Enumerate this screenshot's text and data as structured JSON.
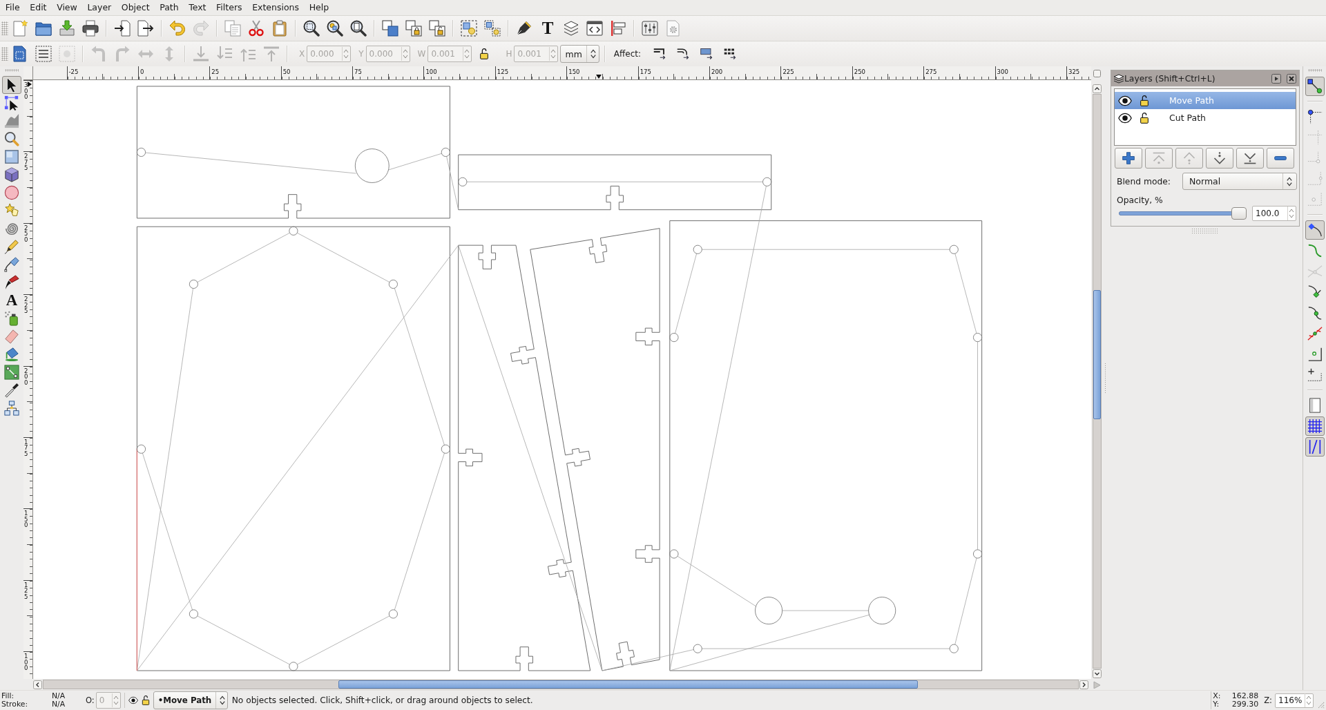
{
  "menu": [
    "File",
    "Edit",
    "View",
    "Layer",
    "Object",
    "Path",
    "Text",
    "Filters",
    "Extensions",
    "Help"
  ],
  "command_bar": [
    [
      {
        "kind": "new",
        "disabled": false
      },
      {
        "kind": "open",
        "disabled": false
      },
      {
        "kind": "save",
        "disabled": false
      },
      {
        "kind": "print",
        "disabled": false
      }
    ],
    [
      {
        "kind": "import",
        "disabled": false
      },
      {
        "kind": "export",
        "disabled": false
      }
    ],
    [
      {
        "kind": "undo",
        "disabled": false
      },
      {
        "kind": "redo",
        "disabled": true
      }
    ],
    [
      {
        "kind": "copy",
        "disabled": false
      },
      {
        "kind": "cut",
        "disabled": false
      },
      {
        "kind": "paste",
        "disabled": false
      }
    ],
    [
      {
        "kind": "zoom_selection",
        "disabled": false
      },
      {
        "kind": "zoom_drawing",
        "disabled": false
      },
      {
        "kind": "zoom_page",
        "disabled": false
      }
    ],
    [
      {
        "kind": "duplicate",
        "disabled": false
      },
      {
        "kind": "clone",
        "disabled": false
      },
      {
        "kind": "unlink_clone",
        "disabled": false
      }
    ],
    [
      {
        "kind": "group",
        "disabled": false
      },
      {
        "kind": "ungroup",
        "disabled": false
      }
    ],
    [
      {
        "kind": "fill_stroke",
        "disabled": false
      },
      {
        "kind": "text",
        "glyph": "T",
        "disabled": false
      },
      {
        "kind": "layers",
        "disabled": false
      },
      {
        "kind": "xml",
        "disabled": false
      },
      {
        "kind": "align",
        "disabled": false
      }
    ],
    [
      {
        "kind": "document_properties",
        "disabled": false
      },
      {
        "kind": "preferences",
        "disabled": false
      }
    ]
  ],
  "tool_controls": {
    "button_groups": [
      [
        {
          "kind": "select_all",
          "disabled": false
        },
        {
          "kind": "select_all_layers",
          "disabled": false
        },
        {
          "kind": "deselect",
          "disabled": true
        }
      ],
      [
        {
          "kind": "rotate_ccw",
          "disabled": true
        },
        {
          "kind": "rotate_cw",
          "disabled": true
        },
        {
          "kind": "flip_h",
          "disabled": true
        },
        {
          "kind": "flip_v",
          "disabled": true
        }
      ],
      [
        {
          "kind": "lower_bottom",
          "disabled": true
        },
        {
          "kind": "lower",
          "disabled": true
        },
        {
          "kind": "raise",
          "disabled": true
        },
        {
          "kind": "raise_top",
          "disabled": true
        }
      ]
    ],
    "fields": [
      {
        "label": "X",
        "value": "0.000",
        "disabled": true
      },
      {
        "label": "Y",
        "value": "0.000",
        "disabled": true
      },
      {
        "label": "W",
        "value": "0.001",
        "disabled": true
      },
      {
        "label": "H",
        "value": "0.001",
        "disabled": true
      }
    ],
    "unit": "mm",
    "affect_label": "Affect:"
  },
  "tools": [
    {
      "kind": "selector",
      "selected": true
    },
    {
      "kind": "node",
      "selected": false
    },
    {
      "kind": "tweak",
      "selected": false
    },
    {
      "kind": "zoom",
      "selected": false
    },
    {
      "kind": "rect",
      "selected": false
    },
    {
      "kind": "box3d",
      "selected": false
    },
    {
      "kind": "ellipse",
      "selected": false
    },
    {
      "kind": "star",
      "selected": false
    },
    {
      "kind": "spiral",
      "selected": false
    },
    {
      "kind": "pencil",
      "selected": false
    },
    {
      "kind": "pen",
      "selected": false
    },
    {
      "kind": "calligraphy",
      "selected": false
    },
    {
      "kind": "text",
      "glyph": "A",
      "selected": false
    },
    {
      "kind": "spray",
      "selected": false
    },
    {
      "kind": "eraser",
      "selected": false
    },
    {
      "kind": "bucket",
      "selected": false
    },
    {
      "kind": "gradient",
      "selected": false
    },
    {
      "kind": "dropper",
      "selected": false
    },
    {
      "kind": "connector",
      "selected": false
    }
  ],
  "rulers": {
    "horizontal": [
      "-25",
      "0",
      "25",
      "50",
      "75",
      "100",
      "125",
      "150",
      "175",
      "200",
      "225",
      "250",
      "275",
      "300",
      "325"
    ],
    "vertical": [
      "300",
      "275",
      "250",
      "225",
      "200",
      "175",
      "150",
      "125",
      "100"
    ]
  },
  "layers_panel": {
    "title": "Layers (Shift+Ctrl+L)",
    "layers": [
      {
        "name": "Move Path",
        "selected": true,
        "visible": true,
        "locked": false
      },
      {
        "name": "Cut Path",
        "selected": false,
        "visible": true,
        "locked": false
      }
    ],
    "buttons": [
      {
        "kind": "add",
        "disabled": false
      },
      {
        "kind": "raise_top",
        "disabled": true
      },
      {
        "kind": "raise",
        "disabled": true
      },
      {
        "kind": "lower",
        "disabled": false
      },
      {
        "kind": "lower_bottom",
        "disabled": false
      },
      {
        "kind": "remove",
        "disabled": false
      }
    ],
    "blend_label": "Blend mode:",
    "blend_value": "Normal",
    "opacity_label": "Opacity, %",
    "opacity": {
      "level": 1,
      "value": "100.0"
    }
  },
  "snap_bar": [
    [
      {
        "kind": "enable",
        "on": true,
        "disabled": false
      }
    ],
    [
      {
        "kind": "bbox",
        "on": false,
        "disabled": false
      },
      {
        "kind": "bbox_edge",
        "on": false,
        "disabled": true
      },
      {
        "kind": "bbox_corner",
        "on": false,
        "disabled": true
      },
      {
        "kind": "bbox_midpoint",
        "on": false,
        "disabled": true
      },
      {
        "kind": "bbox_center",
        "on": false,
        "disabled": true
      }
    ],
    [
      {
        "kind": "nodes",
        "on": true,
        "disabled": false
      },
      {
        "kind": "path",
        "on": false,
        "disabled": false
      },
      {
        "kind": "intersection",
        "on": false,
        "disabled": true
      },
      {
        "kind": "cusp",
        "on": false,
        "disabled": false
      },
      {
        "kind": "smooth",
        "on": false,
        "disabled": false
      },
      {
        "kind": "midpoint",
        "on": false,
        "disabled": false
      },
      {
        "kind": "object_center",
        "on": false,
        "disabled": false
      },
      {
        "kind": "rotation_center",
        "on": false,
        "disabled": false
      }
    ],
    [
      {
        "kind": "page",
        "on": false,
        "disabled": false
      },
      {
        "kind": "grid",
        "on": true,
        "disabled": false
      },
      {
        "kind": "guide",
        "on": true,
        "disabled": false
      }
    ]
  ],
  "status_bar": {
    "fill_label": "Fill:",
    "fill_value": "N/A",
    "stroke_label": "Stroke:",
    "stroke_value": "N/A",
    "opacity_label": "O:",
    "opacity_value": "0",
    "opacity_disabled": true,
    "layer_visible": true,
    "layer_locked": false,
    "layer": "•Move Path",
    "message": "No objects selected. Click, Shift+click, or drag around objects to select.",
    "x_label": "X:",
    "x_value": "162.88",
    "y_label": "Y:",
    "y_value": "299.30",
    "zoom_label": "Z:",
    "zoom_value": "116%"
  }
}
